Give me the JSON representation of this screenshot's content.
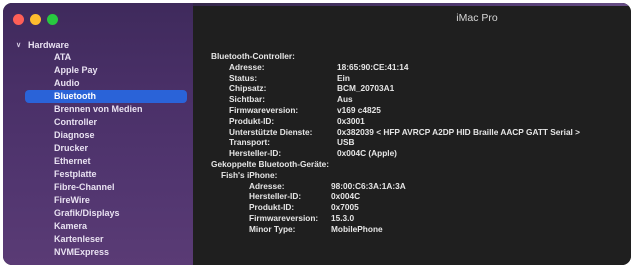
{
  "window": {
    "title": "iMac Pro"
  },
  "sidebar": {
    "group_label": "Hardware",
    "items": [
      {
        "label": "ATA",
        "selected": false
      },
      {
        "label": "Apple Pay",
        "selected": false
      },
      {
        "label": "Audio",
        "selected": false
      },
      {
        "label": "Bluetooth",
        "selected": true
      },
      {
        "label": "Brennen von Medien",
        "selected": false
      },
      {
        "label": "Controller",
        "selected": false
      },
      {
        "label": "Diagnose",
        "selected": false
      },
      {
        "label": "Drucker",
        "selected": false
      },
      {
        "label": "Ethernet",
        "selected": false
      },
      {
        "label": "Festplatte",
        "selected": false
      },
      {
        "label": "Fibre-Channel",
        "selected": false
      },
      {
        "label": "FireWire",
        "selected": false
      },
      {
        "label": "Grafik/Displays",
        "selected": false
      },
      {
        "label": "Kamera",
        "selected": false
      },
      {
        "label": "Kartenleser",
        "selected": false
      },
      {
        "label": "NVMExpress",
        "selected": false
      }
    ]
  },
  "detail": {
    "controller_heading": "Bluetooth-Controller:",
    "controller": [
      {
        "key": "Adresse:",
        "value": "18:65:90:CE:41:14"
      },
      {
        "key": "Status:",
        "value": "Ein"
      },
      {
        "key": "Chipsatz:",
        "value": "BCM_20703A1"
      },
      {
        "key": "Sichtbar:",
        "value": "Aus"
      },
      {
        "key": "Firmwareversion:",
        "value": "v169 c4825"
      },
      {
        "key": "Produkt-ID:",
        "value": "0x3001"
      },
      {
        "key": "Unterstützte Dienste:",
        "value": "0x382039 < HFP AVRCP A2DP HID Braille AACP GATT Serial >"
      },
      {
        "key": "Transport:",
        "value": "USB"
      },
      {
        "key": "Hersteller-ID:",
        "value": "0x004C (Apple)"
      }
    ],
    "paired_heading": "Gekoppelte Bluetooth-Geräte:",
    "device_name": "Fish's iPhone:",
    "device": [
      {
        "key": "Adresse:",
        "value": "98:00:C6:3A:1A:3A"
      },
      {
        "key": "Hersteller-ID:",
        "value": "0x004C"
      },
      {
        "key": "Produkt-ID:",
        "value": "0x7005"
      },
      {
        "key": "Firmwareversion:",
        "value": "15.3.0"
      },
      {
        "key": "Minor Type:",
        "value": "MobilePhone"
      }
    ]
  }
}
